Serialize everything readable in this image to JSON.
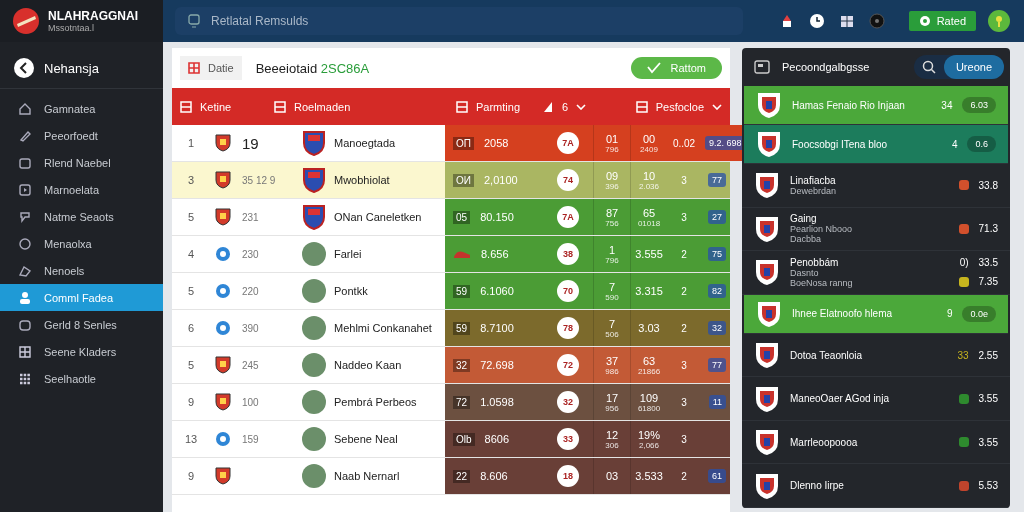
{
  "brand": {
    "name": "NLAHRAGGNAI",
    "subtitle": "Mssotntaa.l"
  },
  "search": {
    "placeholder": "Retlatal Remsulds"
  },
  "top_button": {
    "label": "Rated"
  },
  "sidebar": {
    "back_label": "Nehansja",
    "items": [
      {
        "label": "Gamnatea",
        "selected": false
      },
      {
        "label": "Peeorfoedt",
        "selected": false
      },
      {
        "label": "Rlend Naebel",
        "selected": false
      },
      {
        "label": "Marnoelata",
        "selected": false
      },
      {
        "label": "Natme Seaots",
        "selected": false
      },
      {
        "label": "Menaolxa",
        "selected": false
      },
      {
        "label": "Nenoels",
        "selected": false
      },
      {
        "label": "Comml Fadea",
        "selected": true
      },
      {
        "label": "Gerld 8 Senles",
        "selected": false
      },
      {
        "label": "Seene Kladers",
        "selected": false
      },
      {
        "label": "Seelhaotle",
        "selected": false
      }
    ]
  },
  "main": {
    "chip": "Datie",
    "title": "Beeeiotaid",
    "title_code": "2SC86A",
    "action": "Rattom",
    "columns": [
      {
        "label": "Ketine"
      },
      {
        "label": "Roelmaden"
      },
      {
        "label": "Parmting"
      },
      {
        "label": "6"
      },
      {
        "label": "Pesfocloe"
      }
    ],
    "rows": [
      {
        "rank": "1",
        "kind": "crest",
        "stat": "19",
        "name": "Manoegtada",
        "photo": false,
        "selected": false,
        "tag": "ОП",
        "value": "2058",
        "score": "7A",
        "a": "01",
        "a_sub": "796",
        "b": "00",
        "b_sub": "2409",
        "c": "0..02",
        "d": "9.2. 698",
        "color": "#d5401f"
      },
      {
        "rank": "3",
        "kind": "crest",
        "stat": "35  12  9",
        "name": "Mwobhiolat",
        "photo": false,
        "selected": true,
        "tag": "ОИ",
        "value": "2,0100",
        "score": "74",
        "a": "09",
        "a_sub": "396",
        "b": "10",
        "b_sub": "2.036",
        "c": "3",
        "d": "77",
        "color": "#aab662"
      },
      {
        "rank": "5",
        "kind": "crest",
        "stat": "231",
        "name": "ONan Caneletken",
        "photo": false,
        "selected": false,
        "tag": "05",
        "value": "80.150",
        "score": "7A",
        "a": "87",
        "a_sub": "756",
        "b": "65",
        "b_sub": "01018",
        "c": "3",
        "d": "27",
        "color": "#4b9c35"
      },
      {
        "rank": "4",
        "kind": "ball",
        "stat": "230",
        "name": "Farlei",
        "photo": true,
        "selected": false,
        "value": "8.656",
        "score": "38",
        "a": "1",
        "a_sub": "796",
        "b": "3.555",
        "c": "2",
        "d": "75",
        "color": "#4b9c35"
      },
      {
        "rank": "5",
        "kind": "ball",
        "stat": "220",
        "name": "Pontkk",
        "photo": true,
        "selected": false,
        "tag": "59",
        "value": "6.1060",
        "score": "70",
        "a": "7",
        "a_sub": "590",
        "b": "3.315",
        "c": "2",
        "d": "82",
        "color": "#4b9c35"
      },
      {
        "rank": "6",
        "kind": "ball",
        "stat": "390",
        "name": "Mehlmi Conkanahet",
        "photo": true,
        "selected": false,
        "tag": "59",
        "value": "8.7100",
        "score": "78",
        "a": "7",
        "a_sub": "506",
        "b": "3.03",
        "c": "2",
        "d": "32",
        "color": "#7c6a2c"
      },
      {
        "rank": "5",
        "kind": "crest",
        "stat": "245",
        "name": "Naddeo Kaan",
        "photo": true,
        "selected": false,
        "tag": "32",
        "value": "72.698",
        "score": "72",
        "a": "37",
        "a_sub": "986",
        "b": "63",
        "b_sub": "21866",
        "c": "3",
        "d": "77",
        "color": "#c35a36"
      },
      {
        "rank": "9",
        "kind": "crest",
        "stat": "100",
        "name": "Pembrá Perbeos",
        "photo": true,
        "selected": false,
        "tag": "72",
        "value": "1.0598",
        "score": "32",
        "a": "17",
        "a_sub": "956",
        "b": "109",
        "b_sub": "61800",
        "c": "3",
        "d": "11",
        "color": "#6c5040"
      },
      {
        "rank": "13",
        "kind": "ball",
        "stat": "159",
        "name": "Sebene Neal",
        "photo": true,
        "selected": false,
        "tag": "Olb",
        "value": "8606",
        "score": "33",
        "a": "12",
        "a_sub": "306",
        "b": "19%",
        "b_sub": "2,066",
        "c": "3",
        "color": "#693f37"
      },
      {
        "rank": "9",
        "kind": "crest",
        "name": "Naab Nernarl",
        "photo": true,
        "selected": false,
        "tag": "22",
        "value": "8.606",
        "score": "18",
        "a": "03",
        "b": "3.533",
        "c": "2",
        "d": "61",
        "color": "#693f37"
      }
    ]
  },
  "panel": {
    "title": "Pecoondgalbgsse",
    "button": "Ureone",
    "items": [
      {
        "kind": "featured",
        "color": "#4ba83a",
        "title": "Hamas Fenaio Rio Injaan",
        "count": "34",
        "values": [
          "6.03"
        ]
      },
      {
        "kind": "featured",
        "color": "#1c7c5c",
        "title": "Foocsobgi ITena bloo",
        "count": "4",
        "values": [
          "0.6"
        ]
      },
      {
        "kind": "plain",
        "color": "#d2502c",
        "title": "Linafiacba",
        "lines": [
          "Dewebrdan"
        ],
        "values": [
          "33.8"
        ]
      },
      {
        "kind": "plain",
        "color": "#d2502c",
        "title": "Gaing",
        "lines": [
          "Pearlion Nbooo",
          "Dacbba"
        ],
        "values": [
          "71.3"
        ]
      },
      {
        "kind": "plain",
        "color": "#c7b51e",
        "title": "Penobbám",
        "lines": [
          "Dasnto",
          "BoeNosa ranng"
        ],
        "count": "0)",
        "values": [
          "33.5",
          "7.35"
        ]
      },
      {
        "kind": "featured",
        "color": "#4ba83a",
        "title": "Ihnee Elatnoofo hlema",
        "count": "9",
        "values": [
          "0.0e"
        ]
      },
      {
        "kind": "plain",
        "color": "#c7b51e",
        "title": "Dotoa Teaonloia",
        "count": "33",
        "values": [
          "2.55"
        ]
      },
      {
        "kind": "plain",
        "color": "#2e8a2e",
        "title": "ManeoOaer AGod inja",
        "values": [
          "3.55"
        ]
      },
      {
        "kind": "plain",
        "color": "#2e8a2e",
        "title": "Marrleoopoooa",
        "values": [
          "3.55"
        ]
      },
      {
        "kind": "plain",
        "color": "#c0442c",
        "title": "Dlenno Iirpe",
        "values": [
          "5.53"
        ]
      }
    ]
  }
}
